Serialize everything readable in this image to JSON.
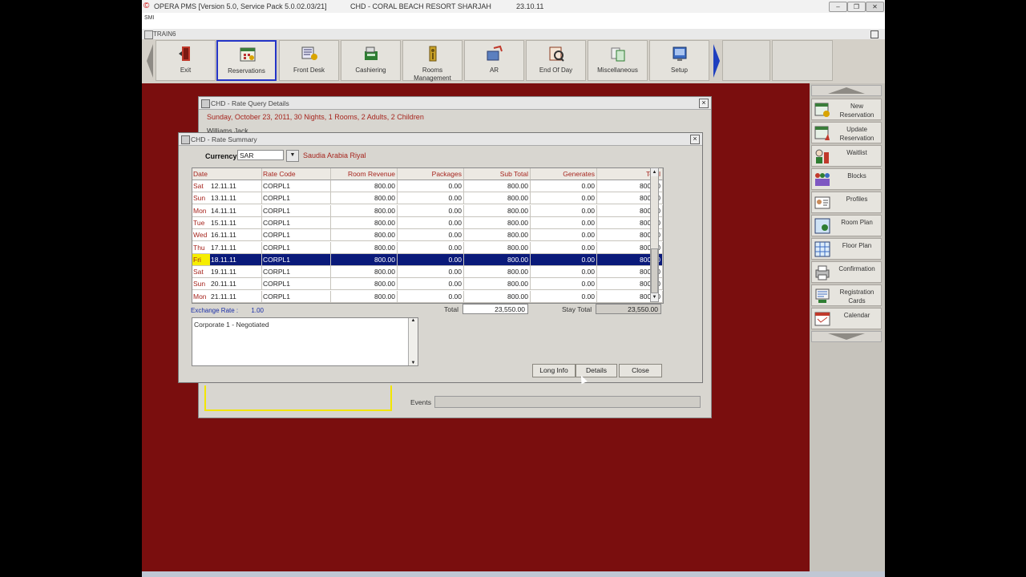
{
  "titlebar": {
    "app": "OPERA PMS [Version 5.0, Service Pack 5.0.02.03/21]",
    "property": "CHD - CORAL BEACH RESORT SHARJAH",
    "date": "23.10.11"
  },
  "tiny_label": "SMI",
  "subwindow": {
    "title": "TRAIN6"
  },
  "toolbar": {
    "items": [
      {
        "label": "Exit"
      },
      {
        "label": "Reservations"
      },
      {
        "label": "Front Desk"
      },
      {
        "label": "Cashiering"
      },
      {
        "label": "Rooms Management"
      },
      {
        "label": "AR"
      },
      {
        "label": "End Of Day"
      },
      {
        "label": "Miscellaneous"
      },
      {
        "label": "Setup"
      }
    ]
  },
  "sidebar": {
    "items": [
      {
        "label": "New Reservation"
      },
      {
        "label": "Update Reservation"
      },
      {
        "label": "Waitlist"
      },
      {
        "label": "Blocks"
      },
      {
        "label": "Profiles"
      },
      {
        "label": "Room Plan"
      },
      {
        "label": "Floor Plan"
      },
      {
        "label": "Confirmation"
      },
      {
        "label": "Registration Cards"
      },
      {
        "label": "Calendar"
      }
    ]
  },
  "rate_query": {
    "title": "CHD - Rate Query Details",
    "summary": "Sunday, October   23, 2011, 30 Nights, 1 Rooms, 2 Adults, 2 Children",
    "guest": "Williams,Jack",
    "events_label": "Events"
  },
  "rate_summary": {
    "title": "CHD - Rate Summary",
    "currency_label": "Currency",
    "currency_code": "SAR",
    "currency_name": "Saudia Arabia Riyal",
    "columns": [
      "Date",
      "Rate Code",
      "Room Revenue",
      "Packages",
      "Sub Total",
      "Generates",
      "Total"
    ],
    "rows": [
      {
        "day": "Sat",
        "date": "12.11.11",
        "code": "CORPL1",
        "rev": "800.00",
        "pkg": "0.00",
        "sub": "800.00",
        "gen": "0.00",
        "total": "800.00"
      },
      {
        "day": "Sun",
        "date": "13.11.11",
        "code": "CORPL1",
        "rev": "800.00",
        "pkg": "0.00",
        "sub": "800.00",
        "gen": "0.00",
        "total": "800.00"
      },
      {
        "day": "Mon",
        "date": "14.11.11",
        "code": "CORPL1",
        "rev": "800.00",
        "pkg": "0.00",
        "sub": "800.00",
        "gen": "0.00",
        "total": "800.00"
      },
      {
        "day": "Tue",
        "date": "15.11.11",
        "code": "CORPL1",
        "rev": "800.00",
        "pkg": "0.00",
        "sub": "800.00",
        "gen": "0.00",
        "total": "800.00"
      },
      {
        "day": "Wed",
        "date": "16.11.11",
        "code": "CORPL1",
        "rev": "800.00",
        "pkg": "0.00",
        "sub": "800.00",
        "gen": "0.00",
        "total": "800.00"
      },
      {
        "day": "Thu",
        "date": "17.11.11",
        "code": "CORPL1",
        "rev": "800.00",
        "pkg": "0.00",
        "sub": "800.00",
        "gen": "0.00",
        "total": "800.00"
      },
      {
        "day": "Fri",
        "date": "18.11.11",
        "code": "CORPL1",
        "rev": "800.00",
        "pkg": "0.00",
        "sub": "800.00",
        "gen": "0.00",
        "total": "800.00",
        "selected": true
      },
      {
        "day": "Sat",
        "date": "19.11.11",
        "code": "CORPL1",
        "rev": "800.00",
        "pkg": "0.00",
        "sub": "800.00",
        "gen": "0.00",
        "total": "800.00"
      },
      {
        "day": "Sun",
        "date": "20.11.11",
        "code": "CORPL1",
        "rev": "800.00",
        "pkg": "0.00",
        "sub": "800.00",
        "gen": "0.00",
        "total": "800.00"
      },
      {
        "day": "Mon",
        "date": "21.11.11",
        "code": "CORPL1",
        "rev": "800.00",
        "pkg": "0.00",
        "sub": "800.00",
        "gen": "0.00",
        "total": "800.00"
      }
    ],
    "exchange_label": "Exchange Rate :",
    "exchange_value": "1.00",
    "total_label": "Total",
    "total_value": "23,550.00",
    "stay_total_label": "Stay Total",
    "stay_total_value": "23,550.00",
    "memo": "Corporate 1 - Negotiated",
    "buttons": {
      "long_info": "Long Info",
      "details": "Details",
      "close": "Close"
    }
  },
  "colors": {
    "accent_red": "#a6251e",
    "selection": "#0a1a7a",
    "background": "#7a0e0e"
  }
}
